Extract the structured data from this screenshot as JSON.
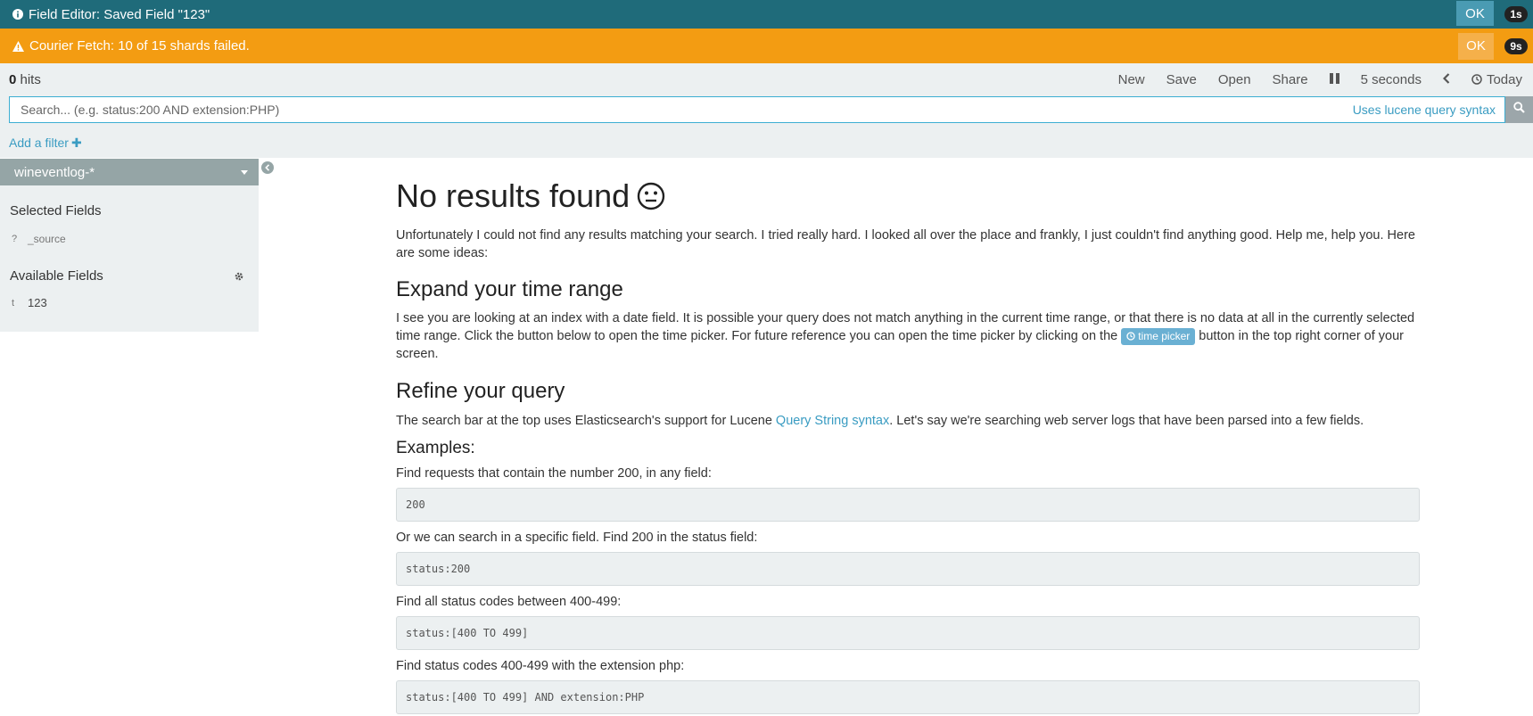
{
  "toasts": {
    "info": {
      "message": "Field Editor: Saved Field \"123\"",
      "ok_label": "OK",
      "timer": "1s",
      "icon": "info-circle-icon"
    },
    "warning": {
      "message": "Courier Fetch: 10 of 15 shards failed.",
      "ok_label": "OK",
      "timer": "9s",
      "icon": "warning-triangle-icon"
    }
  },
  "topnav": {
    "hits_count": "0",
    "hits_label": " hits",
    "items": {
      "new": "New",
      "save": "Save",
      "open": "Open",
      "share": "Share",
      "interval": "5 seconds",
      "time_range": "Today"
    }
  },
  "search": {
    "placeholder": "Search... (e.g. status:200 AND extension:PHP)",
    "value": "",
    "syntax_link": "Uses lucene query syntax"
  },
  "filter": {
    "add_label": "Add a filter",
    "plus": "✚"
  },
  "sidebar": {
    "index_pattern": "wineventlog-*",
    "selected_title": "Selected Fields",
    "selected_fields": [
      {
        "type": "?",
        "name": "_source"
      }
    ],
    "available_title": "Available Fields",
    "available_fields": [
      {
        "type": "t",
        "name": "123"
      }
    ]
  },
  "main": {
    "title": "No results found",
    "intro": "Unfortunately I could not find any results matching your search. I tried really hard. I looked all over the place and frankly, I just couldn't find anything good. Help me, help you. Here are some ideas:",
    "time_heading": "Expand your time range",
    "time_para_before": "I see you are looking at an index with a date field. It is possible your query does not match anything in the current time range, or that there is no data at all in the currently selected time range. Click the button below to open the time picker. For future reference you can open the time picker by clicking on the ",
    "time_picker_badge": "time picker",
    "time_para_after": " button in the top right corner of your screen.",
    "refine_heading": "Refine your query",
    "refine_before": "The search bar at the top uses Elasticsearch's support for Lucene ",
    "refine_link": "Query String syntax",
    "refine_after": ". Let's say we're searching web server logs that have been parsed into a few fields.",
    "examples_heading": "Examples:",
    "examples": [
      {
        "label": "Find requests that contain the number 200, in any field:",
        "code": "200"
      },
      {
        "label": "Or we can search in a specific field. Find 200 in the status field:",
        "code": "status:200"
      },
      {
        "label": "Find all status codes between 400-499:",
        "code": "status:[400 TO 499]"
      },
      {
        "label": "Find status codes 400-499 with the extension php:",
        "code": "status:[400 TO 499] AND extension:PHP"
      }
    ]
  }
}
